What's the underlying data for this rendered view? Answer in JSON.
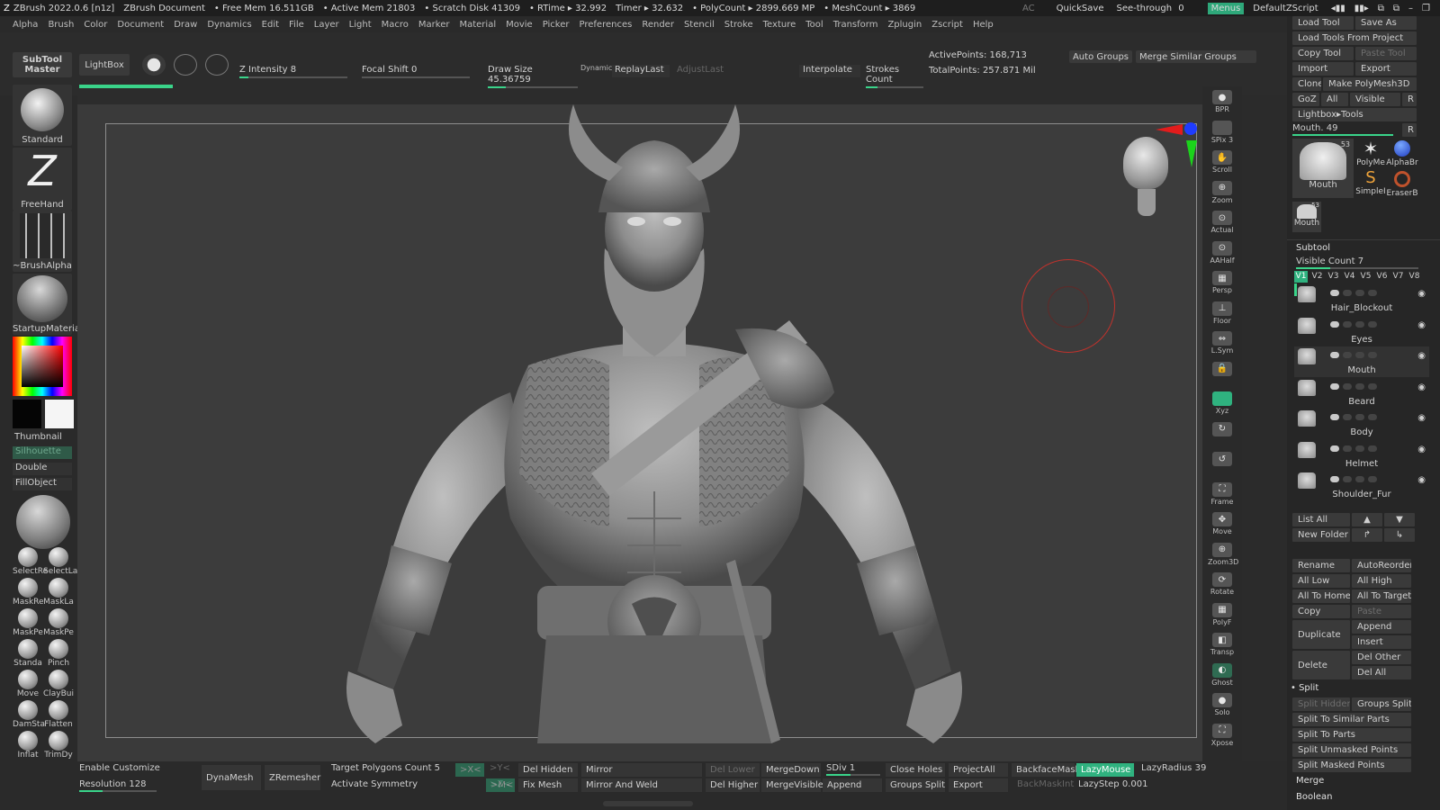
{
  "titlebar": {
    "app": "ZBrush 2022.0.6 [n1z]",
    "document": "ZBrush Document",
    "free_mem": "• Free Mem 16.511GB",
    "active_mem": "• Active Mem 21803",
    "scratch": "• Scratch Disk 41309",
    "rtime": "• RTime ▸ 32.992",
    "timer": "Timer ▸ 32.632",
    "polycount": "• PolyCount ▸ 2899.669 MP",
    "meshcount": "• MeshCount ▸ 3869",
    "ac": "AC",
    "quicksave": "QuickSave",
    "seethrough": "See-through",
    "seethrough_value": "0",
    "menus": "Menus",
    "default_script": "DefaultZScript",
    "window_controls": [
      "▪",
      "–",
      "▫",
      "✕"
    ]
  },
  "menubar": [
    "Alpha",
    "Brush",
    "Color",
    "Document",
    "Draw",
    "Dynamics",
    "Edit",
    "File",
    "Layer",
    "Light",
    "Macro",
    "Marker",
    "Material",
    "Movie",
    "Picker",
    "Preferences",
    "Render",
    "Stencil",
    "Stroke",
    "Texture",
    "Tool",
    "Transform",
    "Zplugin",
    "Zscript",
    "Help"
  ],
  "toolbar": {
    "subtool_master_1": "SubTool",
    "subtool_master_2": "Master",
    "lightbox": "LightBox",
    "z_intensity": "Z Intensity 8",
    "focal_shift": "Focal Shift 0",
    "draw_size": "Draw Size 45.36759",
    "dynamic": "Dynamic",
    "replay_last": "ReplayLast",
    "adjust_last": "AdjustLast",
    "interpolate": "Interpolate",
    "strokes_count": "Strokes Count",
    "active_points": "ActivePoints: 168,713",
    "total_points": "TotalPoints: 257.871 Mil",
    "auto_groups": "Auto Groups",
    "merge_similar_groups": "Merge Similar Groups",
    "z_intensity_level": 0.08,
    "draw_size_level": 0.2
  },
  "leftshelf": {
    "standard": "Standard",
    "freehand": "FreeHand",
    "brush_alpha": "~BrushAlpha",
    "startup_material": "StartupMateria",
    "thumbnail": "Thumbnail",
    "silhouette": "Silhouette",
    "double": "Double",
    "fill_object": "FillObject",
    "small_brushes": [
      {
        "id": "select-rect",
        "label": "SelectRe"
      },
      {
        "id": "select-lasso",
        "label": "SelectLa"
      },
      {
        "id": "mask-rect",
        "label": "MaskRe"
      },
      {
        "id": "mask-lasso",
        "label": "MaskLa"
      },
      {
        "id": "mask-pen",
        "label": "MaskPe"
      },
      {
        "id": "mask-pen-2",
        "label": "MaskPe"
      },
      {
        "id": "standard",
        "label": "Standa"
      },
      {
        "id": "pinch",
        "label": "Pinch"
      },
      {
        "id": "move",
        "label": "Move"
      },
      {
        "id": "claybuildup",
        "label": "ClayBui"
      },
      {
        "id": "damstandard",
        "label": "DamSta"
      },
      {
        "id": "flatten",
        "label": "Flatten"
      },
      {
        "id": "inflat",
        "label": "Inflat"
      },
      {
        "id": "trimdynamic",
        "label": "TrimDy"
      }
    ]
  },
  "rightstrip": [
    {
      "id": "bpr",
      "label": "BPR",
      "glyph": "●"
    },
    {
      "id": "spix",
      "label": "SPix 3",
      "glyph": ""
    },
    {
      "id": "scroll",
      "label": "Scroll",
      "glyph": "✋"
    },
    {
      "id": "zoom",
      "label": "Zoom",
      "glyph": "⊕"
    },
    {
      "id": "actual",
      "label": "Actual",
      "glyph": "⊙"
    },
    {
      "id": "aahalf",
      "label": "AAHalf",
      "glyph": "⊙"
    },
    {
      "id": "persp",
      "label": "Persp",
      "glyph": "▦"
    },
    {
      "id": "floor",
      "label": "Floor",
      "glyph": "⊥"
    },
    {
      "id": "lsym",
      "label": "L.Sym",
      "glyph": "⇔"
    },
    {
      "id": "lock",
      "label": "",
      "glyph": "🔒"
    },
    {
      "id": "xyz",
      "label": "Xyz",
      "glyph": ""
    },
    {
      "id": "rot1",
      "label": "",
      "glyph": "↻"
    },
    {
      "id": "rot2",
      "label": "",
      "glyph": "↺"
    },
    {
      "id": "frame",
      "label": "Frame",
      "glyph": "⛶"
    },
    {
      "id": "move",
      "label": "Move",
      "glyph": "✥"
    },
    {
      "id": "zoom3d",
      "label": "Zoom3D",
      "glyph": "⊕"
    },
    {
      "id": "rotate",
      "label": "Rotate",
      "glyph": "⟳"
    },
    {
      "id": "polyf",
      "label": "PolyF",
      "glyph": "▦"
    },
    {
      "id": "transp",
      "label": "Transp",
      "glyph": "◧"
    },
    {
      "id": "ghost",
      "label": "Ghost",
      "glyph": "◐"
    },
    {
      "id": "solo",
      "label": "Solo",
      "glyph": "●"
    },
    {
      "id": "xpose",
      "label": "Xpose",
      "glyph": "⛶"
    }
  ],
  "rightpanel": {
    "load_tool": "Load Tool",
    "save_as": "Save As",
    "load_tools_from_project": "Load Tools From Project",
    "copy_tool": "Copy Tool",
    "paste_tool": "Paste Tool",
    "import": "Import",
    "export": "Export",
    "clone": "Clone",
    "make_polymesh3d": "Make PolyMesh3D",
    "goz": "GoZ",
    "all": "All",
    "visible": "Visible",
    "r": "R",
    "lightbox_tools": "Lightbox▸Tools",
    "mouth_slider": "Mouth. 49",
    "r2": "R",
    "tool_thumbs": [
      {
        "label": "Mouth",
        "count": "53"
      },
      {
        "label": "PolyMe",
        "count": ""
      },
      {
        "label": "AlphaBr",
        "count": ""
      },
      {
        "label": "SimpleI",
        "count": ""
      },
      {
        "label": "EraserB",
        "count": ""
      }
    ],
    "mouth_small": "Mouth",
    "mouth_small_count": "53",
    "subtool_header": "Subtool",
    "visible_count": "Visible Count 7",
    "versions": [
      "V1",
      "V2",
      "V3",
      "V4",
      "V5",
      "V6",
      "V7",
      "V8"
    ],
    "subtools": [
      "Hair_Blockout",
      "Eyes",
      "Mouth",
      "Beard",
      "Body",
      "Helmet",
      "Shoulder_Fur"
    ],
    "list_all": "List All",
    "new_folder": "New Folder",
    "rename": "Rename",
    "auto_reorder": "AutoReorder",
    "all_low": "All Low",
    "all_high": "All High",
    "all_to_home": "All To Home",
    "all_to_target": "All To Target",
    "copy": "Copy",
    "paste": "Paste",
    "duplicate": "Duplicate",
    "append": "Append",
    "insert": "Insert",
    "delete": "Delete",
    "del_other": "Del Other",
    "del_all": "Del All",
    "split": "Split",
    "split_hidden": "Split Hidden",
    "groups_split": "Groups Split",
    "split_to_similar_parts": "Split To Similar Parts",
    "split_to_parts": "Split To Parts",
    "split_unmasked_points": "Split Unmasked Points",
    "split_masked_points": "Split Masked Points",
    "merge": "Merge",
    "boolean": "Boolean"
  },
  "bottombar": {
    "enable_customize": "Enable Customize",
    "resolution": "Resolution 128",
    "dynamesh": "DynaMesh",
    "zremesher": "ZRemesher",
    "target_polygons": "Target Polygons Count 5",
    "activate_symmetry": "Activate Symmetry",
    "x_sym": ">X<",
    "y_sym": ">Y<",
    "z_sym": ">Z<",
    "m_sym": ">M<",
    "del_hidden": "Del Hidden",
    "fix_mesh": "Fix Mesh",
    "mirror": "Mirror",
    "mirror_and_weld": "Mirror And Weld",
    "del_lower": "Del Lower",
    "del_higher": "Del Higher",
    "merge_down": "MergeDown",
    "merge_visible": "MergeVisible",
    "sdiv": "SDiv 1",
    "append": "Append",
    "close_holes": "Close Holes",
    "groups_split": "Groups Split",
    "project_all": "ProjectAll",
    "export": "Export",
    "backface_mask": "BackfaceMask",
    "backmask_int": "BackMaskInt",
    "lazy_mouse": "LazyMouse",
    "lazy_radius": "LazyRadius 39",
    "lazy_step": "LazyStep 0.001"
  },
  "colors": {
    "accent_green": "#2fb27f",
    "panel_bg": "#262626",
    "canvas_bg": "#3a3a3a"
  }
}
